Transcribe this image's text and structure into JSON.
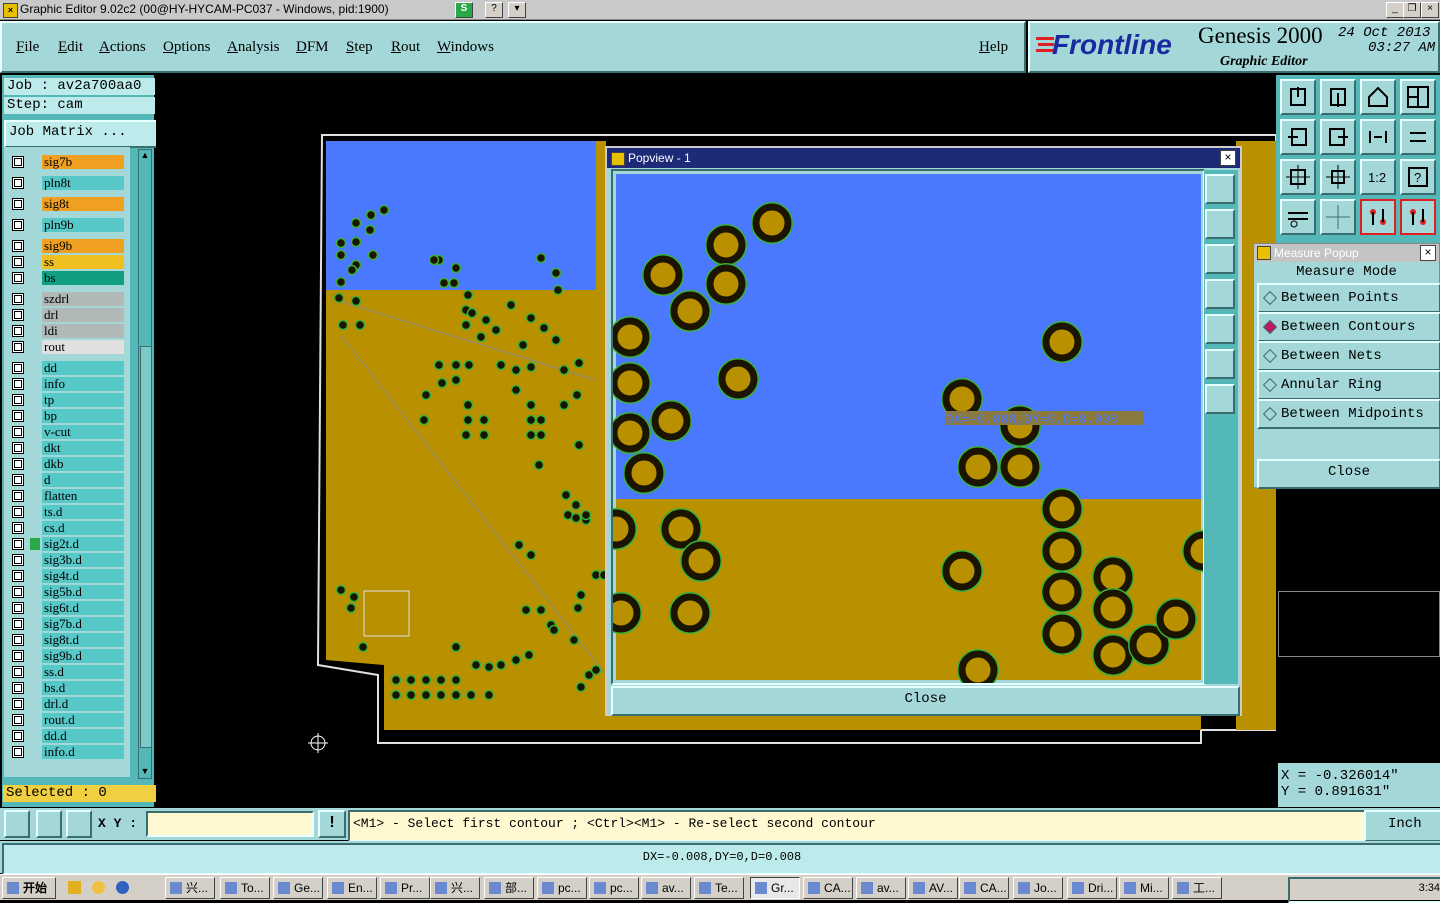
{
  "window": {
    "title": "Graphic Editor 9.02c2 (00@HY-HYCAM-PC037 - Windows, pid:1900)"
  },
  "menu": [
    "File",
    "Edit",
    "Actions",
    "Options",
    "Analysis",
    "DFM",
    "Step",
    "Rout",
    "Windows"
  ],
  "help": "Help",
  "brand": {
    "logo": "Frontline",
    "product": "Genesis 2000",
    "subtitle": "Graphic Editor",
    "date": "24 Oct 2013",
    "time": "03:27 AM"
  },
  "job": {
    "job_label": "Job : av2a700aa0",
    "step_label": "Step: cam",
    "matrix_button": "Job Matrix ..."
  },
  "layers": [
    {
      "name": "sig7b",
      "color": "#f0a020",
      "arrow": true
    },
    {
      "name": "pln8t",
      "color": "#56c8c8",
      "arrow": false
    },
    {
      "name": "sig8t",
      "color": "#f0a020",
      "arrow": true
    },
    {
      "name": "pln9b",
      "color": "#56c8c8",
      "arrow": false
    },
    {
      "name": "sig9b",
      "color": "#f0a020",
      "arrow": true
    },
    {
      "name": "ss",
      "color": "#f0c020",
      "arrow": false
    },
    {
      "name": "bs",
      "color": "#10a080",
      "arrow": false
    },
    {
      "name": "szdrl",
      "color": "#b0b8b8",
      "arrow": false
    },
    {
      "name": "drl",
      "color": "#b0b8b8",
      "arrow": false
    },
    {
      "name": "ldi",
      "color": "#b0b8b8",
      "arrow": false
    },
    {
      "name": "rout",
      "color": "#e0e0e0",
      "arrow": false
    },
    {
      "name": "dd",
      "color": "#56c8c8",
      "arrow": false
    },
    {
      "name": "info",
      "color": "#56c8c8",
      "arrow": true
    },
    {
      "name": "tp",
      "color": "#56c8c8",
      "arrow": false
    },
    {
      "name": "bp",
      "color": "#56c8c8",
      "arrow": false
    },
    {
      "name": "v-cut",
      "color": "#56c8c8",
      "arrow": false
    },
    {
      "name": "dkt",
      "color": "#56c8c8",
      "arrow": false
    },
    {
      "name": "dkb",
      "color": "#56c8c8",
      "arrow": false
    },
    {
      "name": "d",
      "color": "#56c8c8",
      "arrow": false
    },
    {
      "name": "flatten",
      "color": "#56c8c8",
      "arrow": false
    },
    {
      "name": "ts.d",
      "color": "#56c8c8",
      "arrow": false
    },
    {
      "name": "cs.d",
      "color": "#56c8c8",
      "arrow": false
    },
    {
      "name": "sig2t.d",
      "color": "#56c8c8",
      "arrow": true
    },
    {
      "name": "sig3b.d",
      "color": "#56c8c8",
      "arrow": false
    },
    {
      "name": "sig4t.d",
      "color": "#56c8c8",
      "arrow": true
    },
    {
      "name": "sig5b.d",
      "color": "#56c8c8",
      "arrow": true
    },
    {
      "name": "sig6t.d",
      "color": "#56c8c8",
      "arrow": true
    },
    {
      "name": "sig7b.d",
      "color": "#56c8c8",
      "arrow": true
    },
    {
      "name": "sig8t.d",
      "color": "#56c8c8",
      "arrow": true
    },
    {
      "name": "sig9b.d",
      "color": "#56c8c8",
      "arrow": true
    },
    {
      "name": "ss.d",
      "color": "#56c8c8",
      "arrow": false
    },
    {
      "name": "bs.d",
      "color": "#56c8c8",
      "arrow": false
    },
    {
      "name": "drl.d",
      "color": "#56c8c8",
      "arrow": false
    },
    {
      "name": "rout.d",
      "color": "#56c8c8",
      "arrow": false
    },
    {
      "name": "dd.d",
      "color": "#56c8c8",
      "arrow": false
    },
    {
      "name": "info.d",
      "color": "#56c8c8",
      "arrow": true
    }
  ],
  "selected": "Selected : 0",
  "popview": {
    "title": "Popview - 1",
    "measure_label": "DX=-0.008,DY=0,D=0.008",
    "close": "Close"
  },
  "measure": {
    "title": "Measure Popup",
    "heading": "Measure Mode",
    "options": [
      "Between Points",
      "Between Contours",
      "Between Nets",
      "Annular Ring",
      "Between Midpoints"
    ],
    "selected_index": 1,
    "close": "Close"
  },
  "coords": {
    "x": "X = -0.326014\"",
    "y": "Y = 0.891631\""
  },
  "command": {
    "xy_label": "X Y :",
    "xy_value": "",
    "prompt": "<M1> - Select first contour ; <Ctrl><M1> - Re-select second contour",
    "units": "Inch"
  },
  "status": "DX=-0.008,DY=0,D=0.008",
  "taskbar": {
    "start": "开始",
    "tasks": [
      "兴...",
      "To...",
      "Ge...",
      "En...",
      "Pr...",
      "兴...",
      "部...",
      "pc...",
      "pc...",
      "av...",
      "Te...",
      "Gr...",
      "CA...",
      "av...",
      "AV...",
      "CA...",
      "Jo...",
      "Dri...",
      "Mi...",
      "工..."
    ],
    "clock": "3:34"
  },
  "colors": {
    "board": "#b89000",
    "copper_blue": "#4a78ff",
    "pad": "#1a1400",
    "ring": "#3ab03a",
    "panel": "#a4d8d8"
  }
}
